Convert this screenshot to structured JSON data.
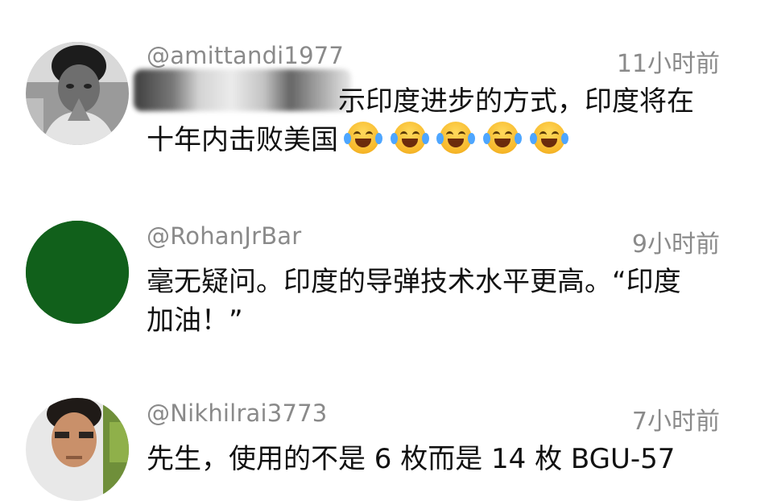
{
  "comments": [
    {
      "username": "@amittandi1977",
      "time": "11小时前",
      "text_line1": "示印度进步的方式，印度将在",
      "text_line2": "十年内击败美国",
      "emoji_count": 5,
      "avatar_icon": "child-photo-avatar"
    },
    {
      "username": "@RohanJrBar",
      "time": "9小时前",
      "text_line1": "毫无疑问。印度的导弹技术水平更高。“印度",
      "text_line2": "加油！”",
      "avatar_color": "#11601b",
      "avatar_icon": "green-circle-avatar"
    },
    {
      "username": "@Nikhilrai3773",
      "time": "7小时前",
      "text_line1": "先生，使用的不是 6 枚而是 14 枚 BGU-57",
      "avatar_icon": "man-photo-avatar"
    }
  ]
}
